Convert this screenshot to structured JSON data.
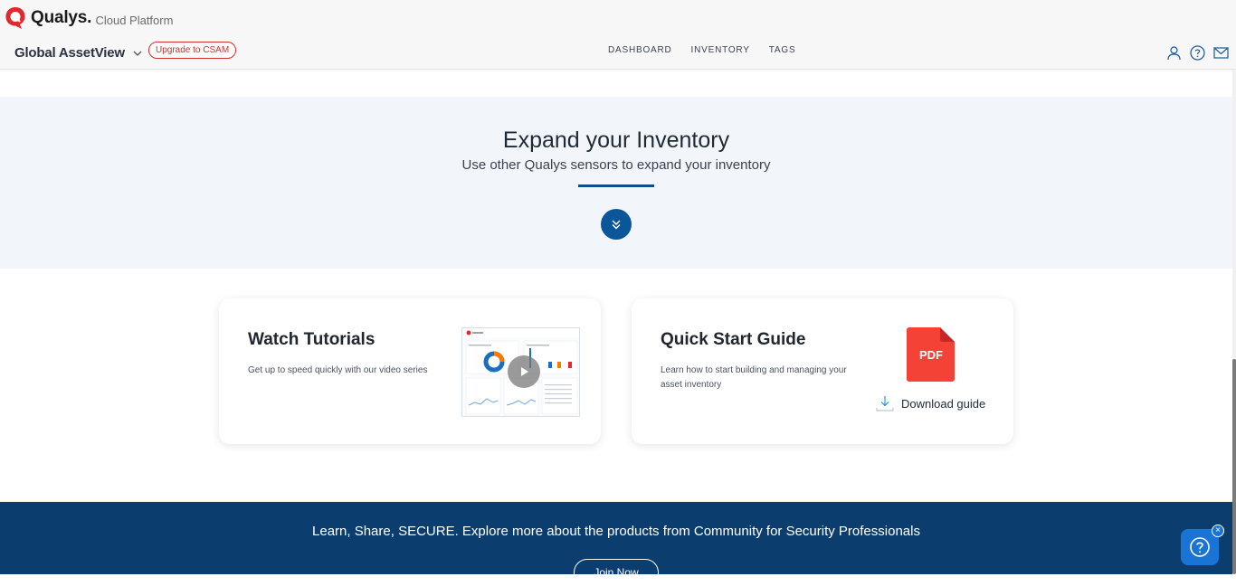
{
  "header": {
    "brand_name": "Qualys",
    "brand_dot": ".",
    "brand_sub": "Cloud Platform",
    "app_name": "Global AssetView",
    "upgrade_label": "Upgrade to CSAM",
    "nav": [
      "DASHBOARD",
      "INVENTORY",
      "TAGS"
    ],
    "icons": [
      "user-icon",
      "help-icon",
      "mail-icon"
    ]
  },
  "expand": {
    "title": "Expand your Inventory",
    "subtitle": "Use other Qualys sensors to expand your inventory"
  },
  "cards": {
    "tutorials": {
      "title": "Watch Tutorials",
      "description": "Get up to speed quickly with our video series"
    },
    "guide": {
      "title": "Quick Start Guide",
      "description": "Learn how to start building and managing your asset inventory",
      "pdf_label": "PDF",
      "download_label": "Download guide"
    }
  },
  "band": {
    "text": "Learn, Share, SECURE. Explore more about the products from Community for Security Professionals",
    "join_label": "Join Now"
  },
  "colors": {
    "brand_red": "#e0282e",
    "accent_blue": "#0b5699",
    "band_blue": "#0b3d6e",
    "pdf_red": "#f44336",
    "upgrade_red": "#d32f2f"
  }
}
